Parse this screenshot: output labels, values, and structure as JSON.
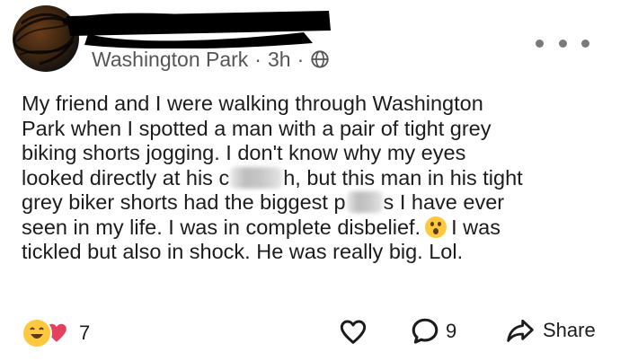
{
  "post": {
    "author": {
      "location": "Washington Park",
      "time": "3h",
      "separator": "·",
      "visibility_icon": "globe-icon"
    },
    "menu_icon": "more-horizontal-icon",
    "body": {
      "line1": "My friend and I were walking through Washington",
      "line2": "Park when I spotted a man with a pair of tight grey",
      "line3": "biking shorts jogging. I don't know why my eyes",
      "line4_a": "looked directly at his c",
      "line4_b": "h, but this man in his tight",
      "line5_a": "grey biker shorts had the biggest p",
      "line5_b": "s I have ever",
      "line6_a": "seen in my life. I was in complete disbelief.",
      "line6_b": "I was",
      "line7": "tickled but also in shock. He was really big. Lol."
    },
    "footer": {
      "reaction_count": "7",
      "reaction_icons": [
        "laughing-emoji-icon",
        "heart-icon"
      ],
      "comment_count": "9",
      "share_label": "Share"
    }
  },
  "colors": {
    "text": "#1c1c1c",
    "meta": "#555555",
    "heart": "#e4405f",
    "laugh": "#ffc83d"
  }
}
